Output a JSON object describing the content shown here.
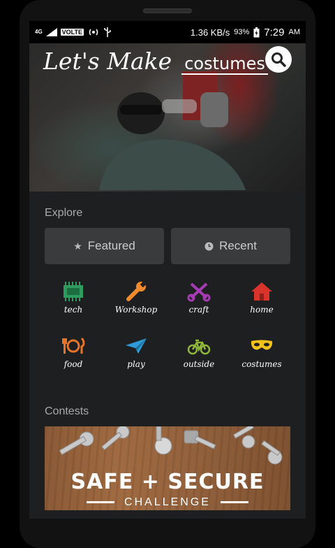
{
  "status_bar": {
    "network": "4G",
    "volte": "VOLTE",
    "speed": "1.36 KB/s",
    "battery": "93%",
    "time": "7:29",
    "ampm": "AM"
  },
  "hero": {
    "title": "Let's Make",
    "word": "costumes"
  },
  "explore": {
    "label": "Explore",
    "tabs": [
      {
        "label": "Featured",
        "icon": "star-icon"
      },
      {
        "label": "Recent",
        "icon": "clock-icon"
      }
    ]
  },
  "categories": [
    {
      "label": "tech",
      "icon": "chip-icon",
      "color": "#2e9c5e"
    },
    {
      "label": "Workshop",
      "icon": "wrench-icon",
      "color": "#f08a2c"
    },
    {
      "label": "craft",
      "icon": "scissors-icon",
      "color": "#a73bb5"
    },
    {
      "label": "home",
      "icon": "house-icon",
      "color": "#d9342b"
    },
    {
      "label": "food",
      "icon": "fork-knife-icon",
      "color": "#e8742a"
    },
    {
      "label": "play",
      "icon": "paper-plane-icon",
      "color": "#2e9ad6"
    },
    {
      "label": "outside",
      "icon": "bicycle-icon",
      "color": "#8fb73a"
    },
    {
      "label": "costumes",
      "icon": "mask-icon",
      "color": "#f3c11c"
    }
  ],
  "contests": {
    "label": "Contests",
    "card": {
      "title": "SAFE + SECURE",
      "subtitle": "CHALLENGE"
    }
  }
}
